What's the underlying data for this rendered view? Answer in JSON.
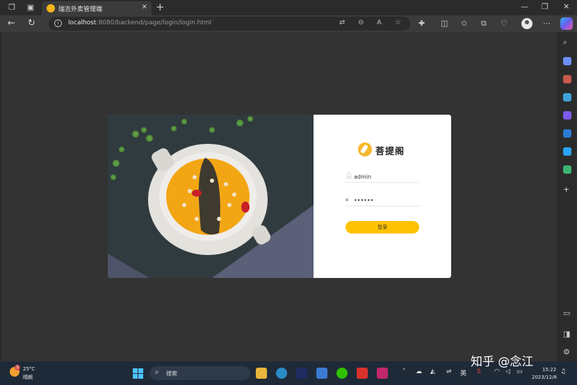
{
  "browser": {
    "tab_title": "瑞吉外卖管理端",
    "address_host": "localhost",
    "address_path": ":8080/backend/page/login/login.html"
  },
  "brand": {
    "name": "菩提阁",
    "logo_color": "#f5b82a"
  },
  "login": {
    "username": "admin",
    "password": "••••••",
    "button_label": "登录",
    "button_color": "#ffc200"
  },
  "taskbar": {
    "weather_temp": "25°C",
    "weather_desc": "晴朗",
    "weather_badge": "1",
    "search_label": "搜索",
    "ime": "英",
    "time": "15:22",
    "date": "2023/12/8"
  },
  "watermark": "知乎 @念江"
}
